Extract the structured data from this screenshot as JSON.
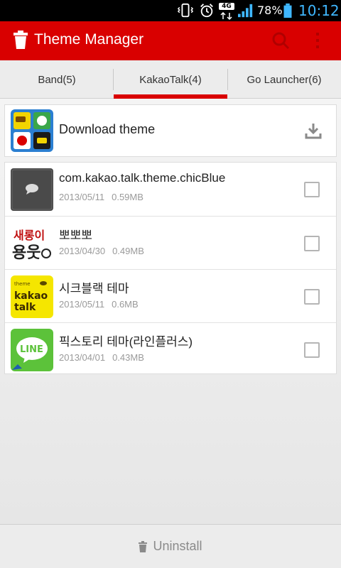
{
  "status_bar": {
    "network_label": "4G",
    "battery_percent": "78%",
    "time": "10:12"
  },
  "action_bar": {
    "title": "Theme Manager"
  },
  "tabs": [
    {
      "label": "Band(5)",
      "selected": false
    },
    {
      "label": "KakaoTalk(4)",
      "selected": true
    },
    {
      "label": "Go Launcher(6)",
      "selected": false
    }
  ],
  "download": {
    "label": "Download theme"
  },
  "themes": [
    {
      "name": "com.kakao.talk.theme.chicBlue",
      "date": "2013/05/11",
      "size": "0.59MB",
      "checked": false
    },
    {
      "name": "뽀뽀뽀",
      "date": "2013/04/30",
      "size": "0.49MB",
      "checked": false
    },
    {
      "name": "시크블랙 테마",
      "date": "2013/05/11",
      "size": "0.6MB",
      "checked": false
    },
    {
      "name": "픽스토리 테마(라인플러스)",
      "date": "2013/04/01",
      "size": "0.43MB",
      "checked": false
    }
  ],
  "bottom_bar": {
    "uninstall_label": "Uninstall"
  },
  "colors": {
    "accent_red": "#d90000",
    "clock_blue": "#3fb7ff"
  }
}
